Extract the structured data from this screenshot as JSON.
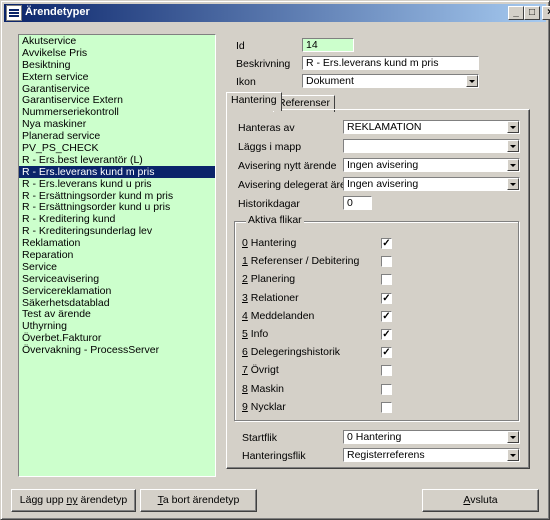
{
  "window": {
    "title": "Ärendetyper"
  },
  "list": {
    "items": [
      "Akutservice",
      "Avvikelse Pris",
      "Besiktning",
      "Extern service",
      "Garantiservice",
      "Garantiservice Extern",
      "Nummerseriekontroll",
      "Nya maskiner",
      "Planerad service",
      "PV_PS_CHECK",
      "R - Ers.best leverantör (L)",
      "R - Ers.leverans kund m pris",
      "R - Ers.leverans kund u pris",
      "R - Ersättningsorder kund m pris",
      "R - Ersättningsorder kund u pris",
      "R - Kreditering kund",
      "R - Krediteringsunderlag lev",
      "Reklamation",
      "Reparation",
      "Service",
      "Serviceavisering",
      "Servicereklamation",
      "Säkerhetsdatablad",
      "Test av ärende",
      "Uthyrning",
      "Överbet.Fakturor",
      "Övervakning - ProcessServer"
    ],
    "selected_index": 11
  },
  "details": {
    "id_label": "Id",
    "id_value": "14",
    "desc_label": "Beskrivning",
    "desc_value": "R - Ers.leverans kund m pris",
    "icon_label": "Ikon",
    "icon_value": "Dokument"
  },
  "tabs": [
    {
      "label": "Hantering"
    },
    {
      "label": "Referenser"
    }
  ],
  "hantering": {
    "hanteras_av_label": "Hanteras av",
    "hanteras_av_value": "REKLAMATION",
    "laggs_i_mapp_label": "Läggs i mapp",
    "laggs_i_mapp_value": "",
    "avisering_nytt_label": "Avisering nytt ärende",
    "avisering_nytt_value": "Ingen avisering",
    "avisering_deleg_label": "Avisering delegerat ärende",
    "avisering_deleg_value": "Ingen avisering",
    "historikdagar_label": "Historikdagar",
    "historikdagar_value": "0",
    "aktiva_flikar_title": "Aktiva flikar",
    "flags": [
      {
        "key": "0",
        "label": " Hantering",
        "checked": true
      },
      {
        "key": "1",
        "label": " Referenser / Debitering",
        "checked": false
      },
      {
        "key": "2",
        "label": " Planering",
        "checked": false
      },
      {
        "key": "3",
        "label": " Relationer",
        "checked": true
      },
      {
        "key": "4",
        "label": " Meddelanden",
        "checked": true
      },
      {
        "key": "5",
        "label": " Info",
        "checked": true
      },
      {
        "key": "6",
        "label": " Delegeringshistorik",
        "checked": true
      },
      {
        "key": "7",
        "label": " Övrigt",
        "checked": false
      },
      {
        "key": "8",
        "label": " Maskin",
        "checked": false
      },
      {
        "key": "9",
        "label": " Nycklar",
        "checked": false
      }
    ],
    "startflik_label": "Startflik",
    "startflik_value": "0 Hantering",
    "hanteringsflik_label": "Hanteringsflik",
    "hanteringsflik_value": "Registerreferens"
  },
  "buttons": {
    "add_pre": "Lägg upp ",
    "add_u": "ny",
    "add_post": " ärendetyp",
    "remove_u": "T",
    "remove_post": "a bort ärendetyp",
    "exit_u": "A",
    "exit_post": "vsluta"
  },
  "colors": {
    "list_bg": "#ccffcc",
    "selection": "#0a246a",
    "titlebar": "#0a246a"
  }
}
